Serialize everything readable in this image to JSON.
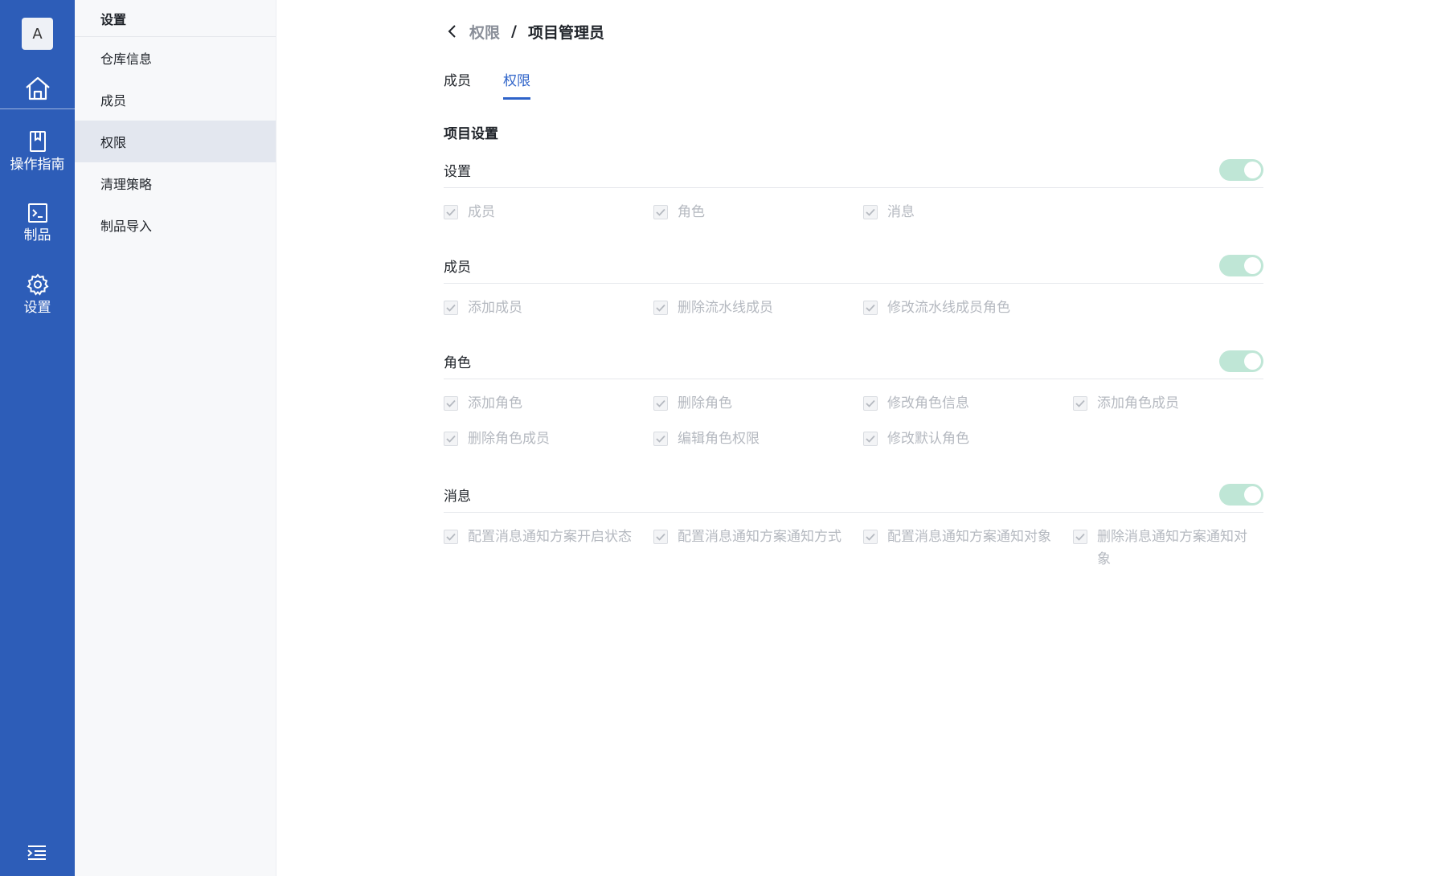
{
  "rail": {
    "avatar": "A",
    "items": [
      {
        "label": "操作指南"
      },
      {
        "label": "制品"
      },
      {
        "label": "设置"
      }
    ]
  },
  "sidebar": {
    "title": "设置",
    "items": [
      {
        "label": "仓库信息"
      },
      {
        "label": "成员"
      },
      {
        "label": "权限",
        "active": true
      },
      {
        "label": "清理策略"
      },
      {
        "label": "制品导入"
      }
    ]
  },
  "breadcrumb": {
    "parent": "权限",
    "separator": "/",
    "current": "项目管理员"
  },
  "tabs": [
    {
      "label": "成员"
    },
    {
      "label": "权限",
      "active": true
    }
  ],
  "section_title": "项目设置",
  "groups": [
    {
      "name": "设置",
      "enabled": true,
      "permissions": [
        "成员",
        "角色",
        "消息"
      ]
    },
    {
      "name": "成员",
      "enabled": true,
      "permissions": [
        "添加成员",
        "删除流水线成员",
        "修改流水线成员角色"
      ]
    },
    {
      "name": "角色",
      "enabled": true,
      "permissions": [
        "添加角色",
        "删除角色",
        "修改角色信息",
        "添加角色成员",
        "删除角色成员",
        "编辑角色权限",
        "修改默认角色"
      ]
    },
    {
      "name": "消息",
      "enabled": true,
      "permissions": [
        "配置消息通知方案开启状态",
        "配置消息通知方案通知方式",
        "配置消息通知方案通知对象",
        "删除消息通知方案通知对象"
      ]
    }
  ],
  "colors": {
    "rail": "#2d5db8",
    "accent": "#2e63c9",
    "toggle_on_disabled": "#bfe6d6",
    "disabled_text": "#b5b9c0"
  }
}
